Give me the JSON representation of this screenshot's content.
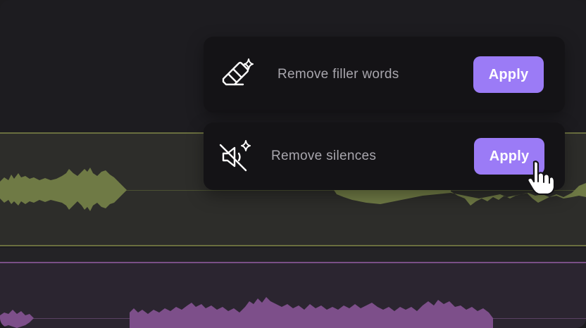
{
  "actions": [
    {
      "label": "Remove filler words",
      "button_label": "Apply",
      "icon": "eraser-sparkle-icon"
    },
    {
      "label": "Remove silences",
      "button_label": "Apply",
      "icon": "mute-sparkle-icon"
    }
  ],
  "colors": {
    "accent": "#9b7bf6",
    "card_bg": "#141316",
    "track_green": "#6f7a45",
    "track_purple": "#7d4f8a"
  },
  "cursor_icon": "hand-pointer-icon"
}
